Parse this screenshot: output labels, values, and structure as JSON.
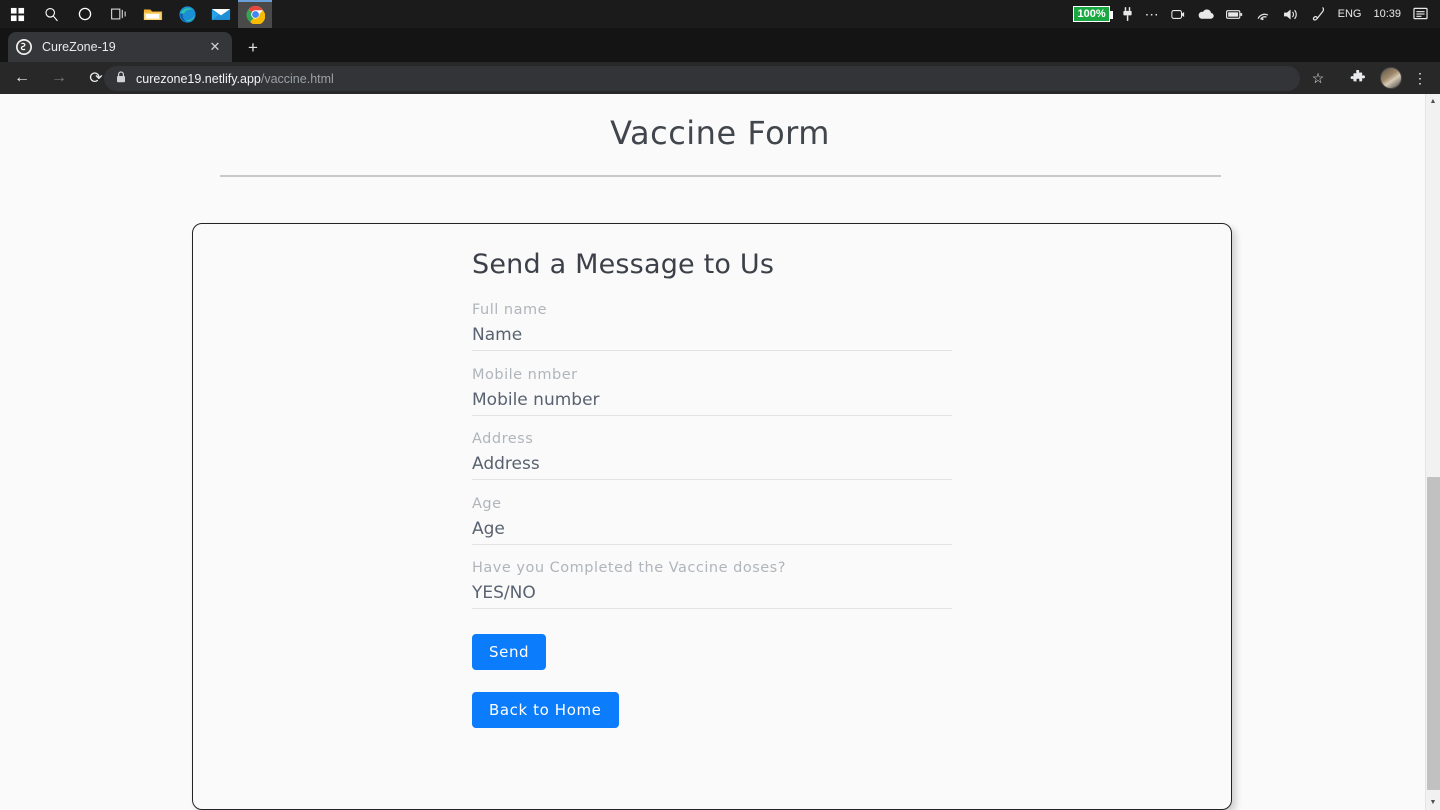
{
  "taskbar": {
    "left_icons": [
      {
        "name": "start-button",
        "glyph": "▦"
      },
      {
        "name": "search-icon",
        "glyph": "⌕"
      },
      {
        "name": "cortana-icon",
        "glyph": "◯"
      },
      {
        "name": "task-view-icon",
        "glyph": "❏|"
      },
      {
        "name": "file-explorer-icon",
        "glyph": "🗀"
      },
      {
        "name": "edge-browser-icon",
        "glyph": "◕"
      },
      {
        "name": "mail-icon",
        "glyph": "✉"
      },
      {
        "name": "chrome-browser-icon",
        "glyph": "◉"
      }
    ],
    "battery_percent": "100%",
    "tray_icons": [
      {
        "name": "power-plug-icon",
        "glyph": "⚡"
      },
      {
        "name": "overflow-icon",
        "glyph": "⋯"
      },
      {
        "name": "camera-icon",
        "glyph": "▣"
      },
      {
        "name": "onedrive-cloud-icon",
        "glyph": "☁"
      },
      {
        "name": "battery-icon",
        "glyph": "▭"
      },
      {
        "name": "wifi-icon",
        "glyph": "◞"
      },
      {
        "name": "volume-icon",
        "glyph": "🔊"
      },
      {
        "name": "pen-icon",
        "glyph": "✎"
      }
    ],
    "language": "ENG",
    "clock": "10:39",
    "notification_icon": "▤"
  },
  "browser": {
    "tab": {
      "title": "CureZone-19",
      "favicon": "S",
      "close_label": "✕"
    },
    "new_tab_label": "+",
    "window_controls": {
      "profile": "▾",
      "minimize": "—",
      "maximize": "◻",
      "close": "✕"
    },
    "toolbar": {
      "back": "←",
      "forward": "→",
      "reload": "⟳",
      "lock": "🔒",
      "url_host": "curezone19.netlify.app",
      "url_path": "/vaccine.html",
      "bookmark_star": "☆",
      "extensions": "🧩",
      "menu": "⋮"
    }
  },
  "page": {
    "title": "Vaccine Form",
    "heading": "Send a Message to Us",
    "fields": [
      {
        "name": "full-name",
        "label": "Full name",
        "placeholder": "Name"
      },
      {
        "name": "mobile-number",
        "label": "Mobile nmber",
        "placeholder": "Mobile number"
      },
      {
        "name": "address",
        "label": "Address",
        "placeholder": "Address"
      },
      {
        "name": "age",
        "label": "Age",
        "placeholder": "Age"
      },
      {
        "name": "vaccine-doses",
        "label": "Have you Completed the Vaccine doses?",
        "placeholder": "YES/NO"
      }
    ],
    "send_button": "Send",
    "home_button": "Back to Home",
    "accent_color": "#0b7cfb",
    "background_color": "#fafafa"
  },
  "scrollbar": {
    "up_arrow": "▲",
    "down_arrow": "▼"
  }
}
